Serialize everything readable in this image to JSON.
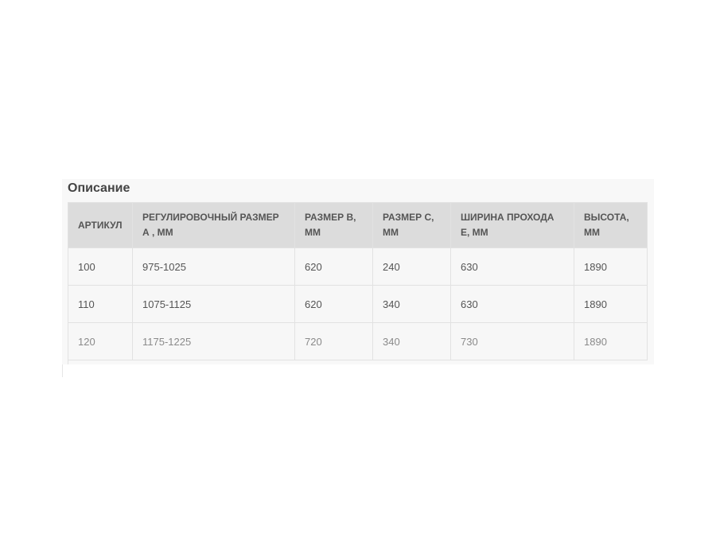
{
  "section": {
    "title": "Описание"
  },
  "table": {
    "headers": [
      "АРТИКУЛ",
      "РЕГУЛИРОВОЧНЫЙ РАЗМЕР А , ММ",
      "РАЗМЕР В, ММ",
      "РАЗМЕР С, ММ",
      "ШИРИНА ПРОХОДА Е, ММ",
      "ВЫСОТА, ММ"
    ],
    "rows": [
      [
        "100",
        "975-1025",
        "620",
        "240",
        "630",
        "1890"
      ],
      [
        "110",
        "1075-1125",
        "620",
        "340",
        "630",
        "1890"
      ],
      [
        "120",
        "1175-1225",
        "720",
        "340",
        "730",
        "1890"
      ]
    ]
  }
}
